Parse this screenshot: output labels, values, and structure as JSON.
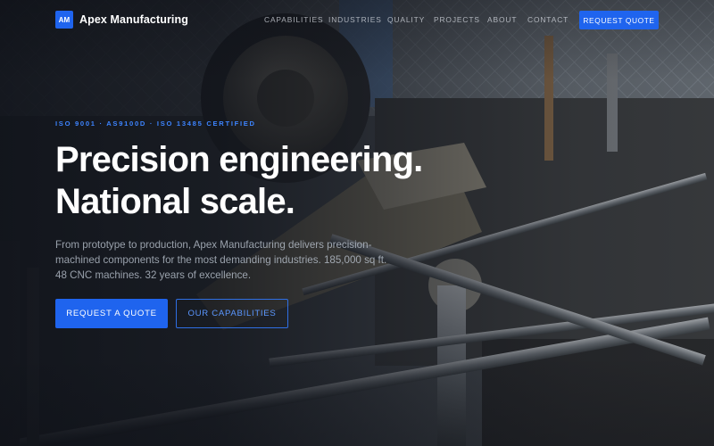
{
  "brand": {
    "mark": "AM",
    "name": "Apex Manufacturing"
  },
  "nav": {
    "items": [
      "CAPABILITIES",
      "INDUSTRIES",
      "QUALITY",
      "PROJECTS",
      "ABOUT",
      "CONTACT"
    ],
    "cta_label": "REQUEST QUOTE"
  },
  "hero": {
    "certifications": "ISO 9001 · AS9100D · ISO 13485 CERTIFIED",
    "headline_line1": "Precision engineering.",
    "headline_line2": "National scale.",
    "subtext": "From prototype to production, Apex Manufacturing delivers precision-machined components for the most demanding industries. 185,000 sq ft. 48 CNC machines. 32 years of excellence.",
    "primary_cta": "REQUEST A QUOTE",
    "secondary_cta": "OUR CAPABILITIES"
  },
  "colors": {
    "accent": "#1f64ee",
    "accent_text": "#3d84ff",
    "overlay": "#0e1118"
  },
  "background_image": "industrial-machinery-photo"
}
